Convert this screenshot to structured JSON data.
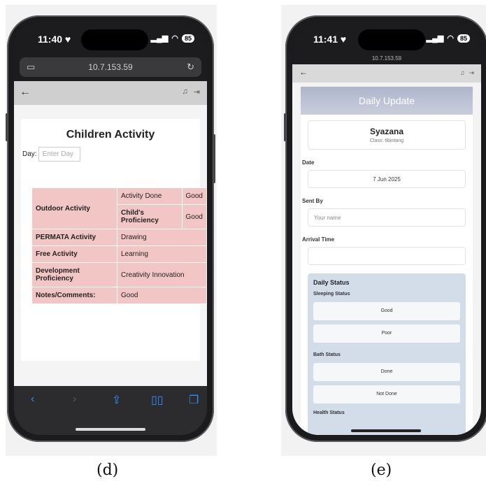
{
  "phone_d": {
    "status": {
      "time": "11:40",
      "battery": "85"
    },
    "url": "10.7.153.59",
    "page": {
      "title": "Children Activity",
      "day_label": "Day:",
      "day_placeholder": "Enter Day",
      "table": {
        "outdoor_label": "Outdoor Activity",
        "activity_done_label": "Activity Done",
        "activity_done_value": "Good",
        "proficiency_label": "Child's Proficiency",
        "proficiency_value": "Good",
        "rows": [
          {
            "label": "PERMATA Activity",
            "value": "Drawing"
          },
          {
            "label": "Free Activity",
            "value": "Learning"
          },
          {
            "label": "Development Proficiency",
            "value": "Creativity Innovation"
          },
          {
            "label": "Notes/Comments:",
            "value": "Good"
          }
        ]
      }
    },
    "caption": "(d)"
  },
  "phone_e": {
    "status": {
      "time": "11:41",
      "battery": "85"
    },
    "url": "10.7.153.59",
    "page": {
      "title": "Daily Update",
      "child_name": "Syazana",
      "child_class": "Class: 6bintang",
      "date_label": "Date",
      "date_value": "7 Jun 2025",
      "sent_by_label": "Sent By",
      "sent_by_placeholder": "Your name",
      "arrival_label": "Arrival Time",
      "arrival_value": "",
      "daily_status_title": "Daily Status",
      "sleeping_label": "Sleeping Status",
      "sleeping_options": [
        "Good",
        "Poor"
      ],
      "bath_label": "Bath Status",
      "bath_options": [
        "Done",
        "Not Done"
      ],
      "health_label": "Health Status"
    },
    "caption": "(e)"
  }
}
